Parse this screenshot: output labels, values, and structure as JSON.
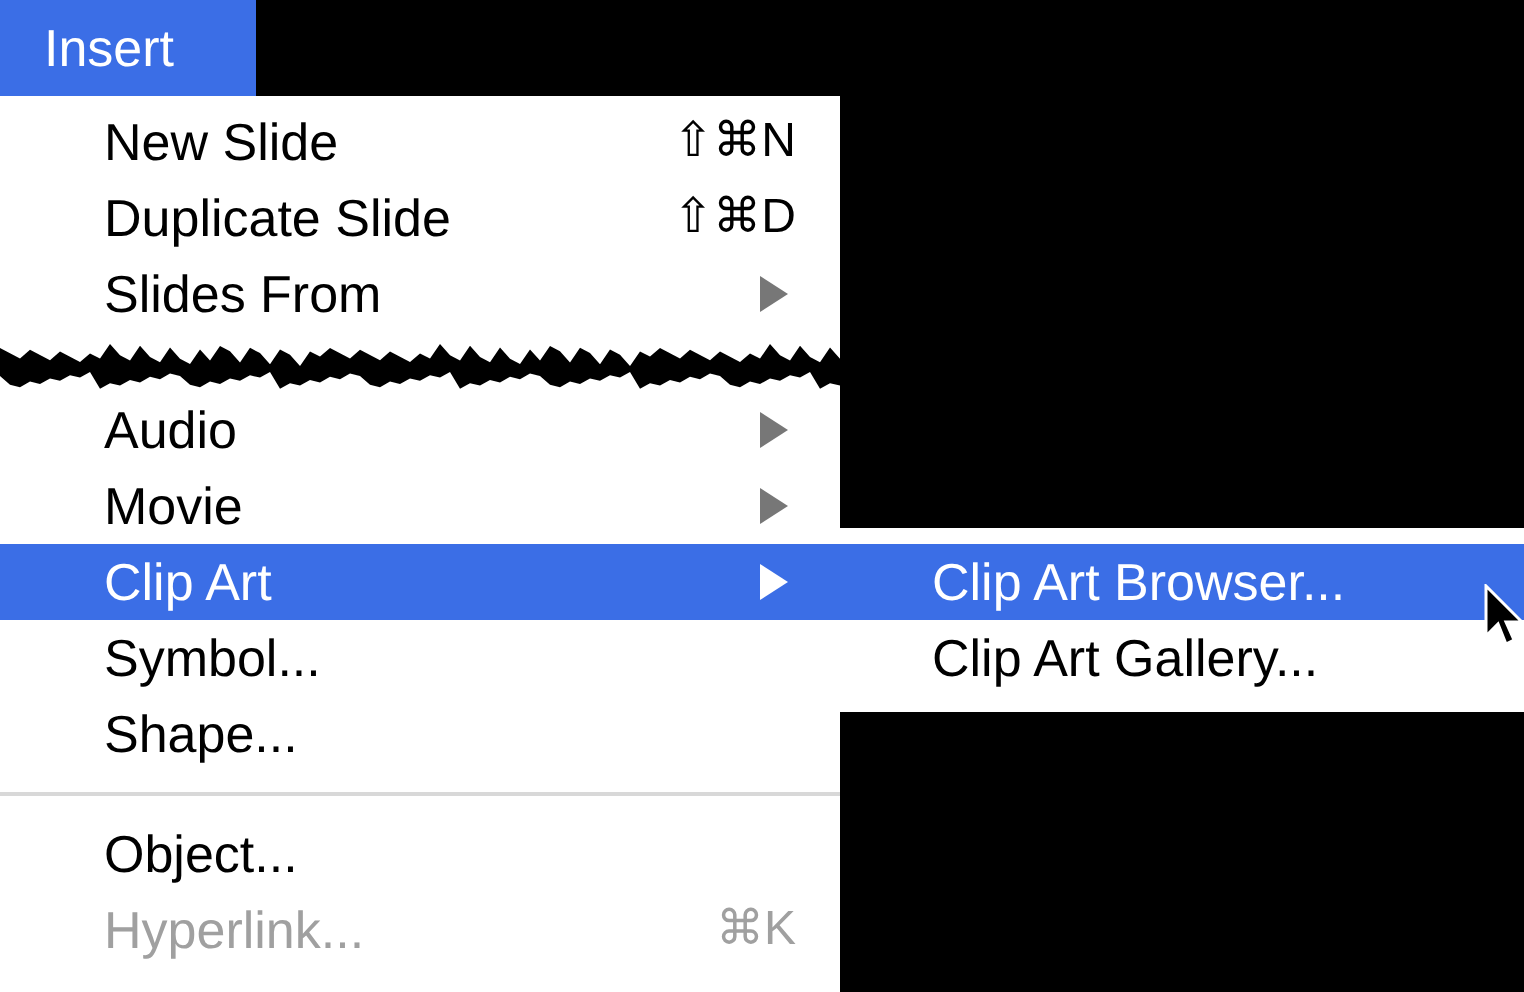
{
  "menu_bar": {
    "title": "Insert",
    "selected": true
  },
  "menu": {
    "items": [
      {
        "kind": "item",
        "label": "New Slide",
        "shortcut": "⇧⌘N",
        "submenu": false,
        "selected": false,
        "disabled": false
      },
      {
        "kind": "item",
        "label": "Duplicate Slide",
        "shortcut": "⇧⌘D",
        "submenu": false,
        "selected": false,
        "disabled": false
      },
      {
        "kind": "item",
        "label": "Slides From",
        "submenu": true,
        "selected": false,
        "disabled": false
      },
      {
        "kind": "tear"
      },
      {
        "kind": "item",
        "label": "Audio",
        "submenu": true,
        "selected": false,
        "disabled": false
      },
      {
        "kind": "item",
        "label": "Movie",
        "submenu": true,
        "selected": false,
        "disabled": false
      },
      {
        "kind": "item",
        "label": "Clip Art",
        "submenu": true,
        "selected": true,
        "disabled": false
      },
      {
        "kind": "item",
        "label": "Symbol...",
        "submenu": false,
        "selected": false,
        "disabled": false
      },
      {
        "kind": "item",
        "label": "Shape...",
        "submenu": false,
        "selected": false,
        "disabled": false
      },
      {
        "kind": "separator"
      },
      {
        "kind": "item",
        "label": "Object...",
        "submenu": false,
        "selected": false,
        "disabled": false
      },
      {
        "kind": "item",
        "label": "Hyperlink...",
        "shortcut": "⌘K",
        "submenu": false,
        "selected": false,
        "disabled": true
      }
    ]
  },
  "submenu": {
    "items": [
      {
        "label": "Clip Art Browser...",
        "selected": true
      },
      {
        "label": "Clip Art Gallery...",
        "selected": false
      }
    ]
  }
}
